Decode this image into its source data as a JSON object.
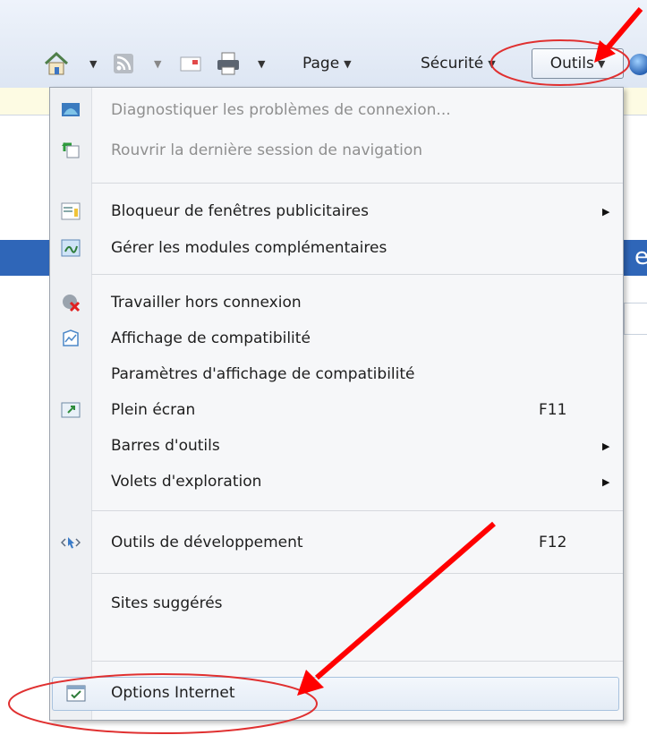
{
  "toolbar": {
    "page_label": "Page",
    "security_label": "Sécurité",
    "tools_label": "Outils"
  },
  "menu": {
    "items": [
      {
        "label": "Diagnostiquer les problèmes de connexion...",
        "icon": "network-diagnose-icon",
        "disabled": true
      },
      {
        "label": "Rouvrir la dernière session de navigation",
        "icon": "reopen-session-icon",
        "disabled": true
      },
      {
        "label": "Bloqueur de fenêtres publicitaires",
        "icon": "popup-blocker-icon",
        "submenu": true
      },
      {
        "label": "Gérer les modules complémentaires",
        "icon": "addons-icon"
      },
      {
        "label": "Travailler hors connexion",
        "icon": "offline-icon"
      },
      {
        "label": "Affichage de compatibilité",
        "icon": "compatibility-icon"
      },
      {
        "label": "Paramètres d'affichage de compatibilité",
        "icon": ""
      },
      {
        "label": "Plein écran",
        "icon": "fullscreen-icon",
        "shortcut": "F11"
      },
      {
        "label": "Barres d'outils",
        "icon": "",
        "submenu": true
      },
      {
        "label": "Volets d'exploration",
        "icon": "",
        "submenu": true
      },
      {
        "label": "Outils de développement",
        "icon": "developer-tools-icon",
        "shortcut": "F12"
      },
      {
        "label": "Sites suggérés",
        "icon": ""
      },
      {
        "label": "Options Internet",
        "icon": "internet-options-icon",
        "highlighted": true
      }
    ]
  },
  "annotations": {
    "arrow_color": "#ff0000",
    "ellipse_color": "#e03030"
  }
}
